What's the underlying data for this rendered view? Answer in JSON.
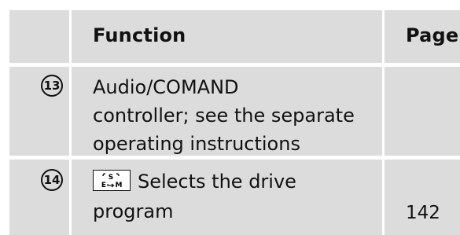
{
  "table": {
    "headers": {
      "function": "Function",
      "page": "Page"
    },
    "rows": [
      {
        "number": "13",
        "function": "Audio/COMAND controller; see the separate operating instructions",
        "function_lines": [
          "Audio/COMAND",
          "controller; see the separate",
          "operating instructions"
        ],
        "page": ""
      },
      {
        "number": "14",
        "icon": "drive-program-switch-icon",
        "icon_labels": {
          "s": "S",
          "e": "E",
          "m": "M"
        },
        "function_lines": [
          "Selects the drive",
          "program"
        ],
        "page": "142"
      }
    ]
  }
}
